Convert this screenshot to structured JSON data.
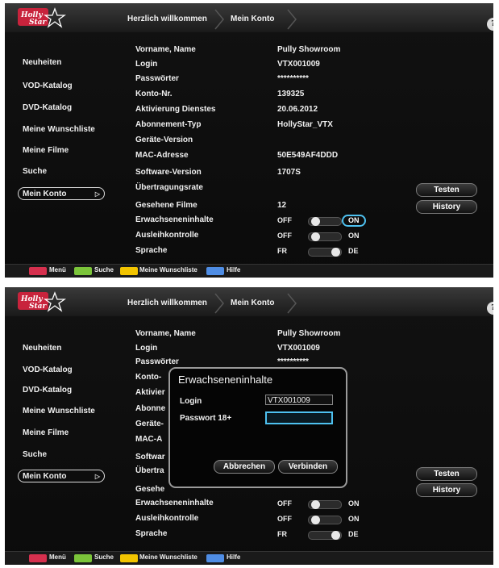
{
  "colors": {
    "red_key": "#d6304e",
    "green_key": "#7bc43a",
    "yellow_key": "#f2c400",
    "blue_key": "#4f8de4",
    "focus": "#4ec1f0"
  },
  "logo": {
    "text": "Holly Star"
  },
  "header": {
    "crumb1": "Herzlich willkommen",
    "crumb2": "Mein Konto",
    "help_icon": "?"
  },
  "sidebar": {
    "items": [
      "Neuheiten",
      "VOD-Katalog",
      "DVD-Katalog",
      "Meine Wunschliste",
      "Meine Filme",
      "Suche",
      "Mein Konto"
    ]
  },
  "account": {
    "rows": [
      {
        "label": "Vorname, Name",
        "value": "Pully Showroom"
      },
      {
        "label": "Login",
        "value": "VTX001009"
      },
      {
        "label": "Passwörter",
        "value": "**********"
      },
      {
        "label": "Konto-Nr.",
        "value": "139325"
      },
      {
        "label": "Aktivierung Dienstes",
        "value": "20.06.2012"
      },
      {
        "label": "Abonnement-Typ",
        "value": "HollyStar_VTX"
      },
      {
        "label": "Geräte-Version",
        "value": ""
      },
      {
        "label": "MAC-Adresse",
        "value": "50E549AF4DDD"
      },
      {
        "label": "Software-Version",
        "value": "1707S"
      },
      {
        "label": "Übertragungsrate",
        "value": ""
      },
      {
        "label": "Gesehene Filme",
        "value": "12"
      }
    ],
    "toggles": [
      {
        "label": "Erwachseneninhalte",
        "off": "OFF",
        "on": "ON",
        "state": "on"
      },
      {
        "label": "Ausleihkontrolle",
        "off": "OFF",
        "on": "ON",
        "state": "off"
      },
      {
        "label": "Sprache",
        "off": "FR",
        "on": "DE",
        "state": "on"
      }
    ],
    "test_button": "Testen",
    "history_button": "History"
  },
  "bottom": {
    "keys": [
      "Menü",
      "Suche",
      "Meine Wunschliste",
      "Hilfe"
    ]
  },
  "dialog": {
    "title": "Erwachseneninhalte",
    "login_label": "Login",
    "login_value": "VTX001009",
    "password_label": "Passwort 18+",
    "password_value": "",
    "cancel": "Abbrechen",
    "connect": "Verbinden"
  },
  "screen2_labels_visible": [
    "Vorname, Name",
    "Login",
    "Passwörter",
    "Konto-",
    "Aktivier",
    "Abonne",
    "Geräte-",
    "MAC-A",
    "Softwar",
    "Übertra",
    "Gesehe"
  ]
}
